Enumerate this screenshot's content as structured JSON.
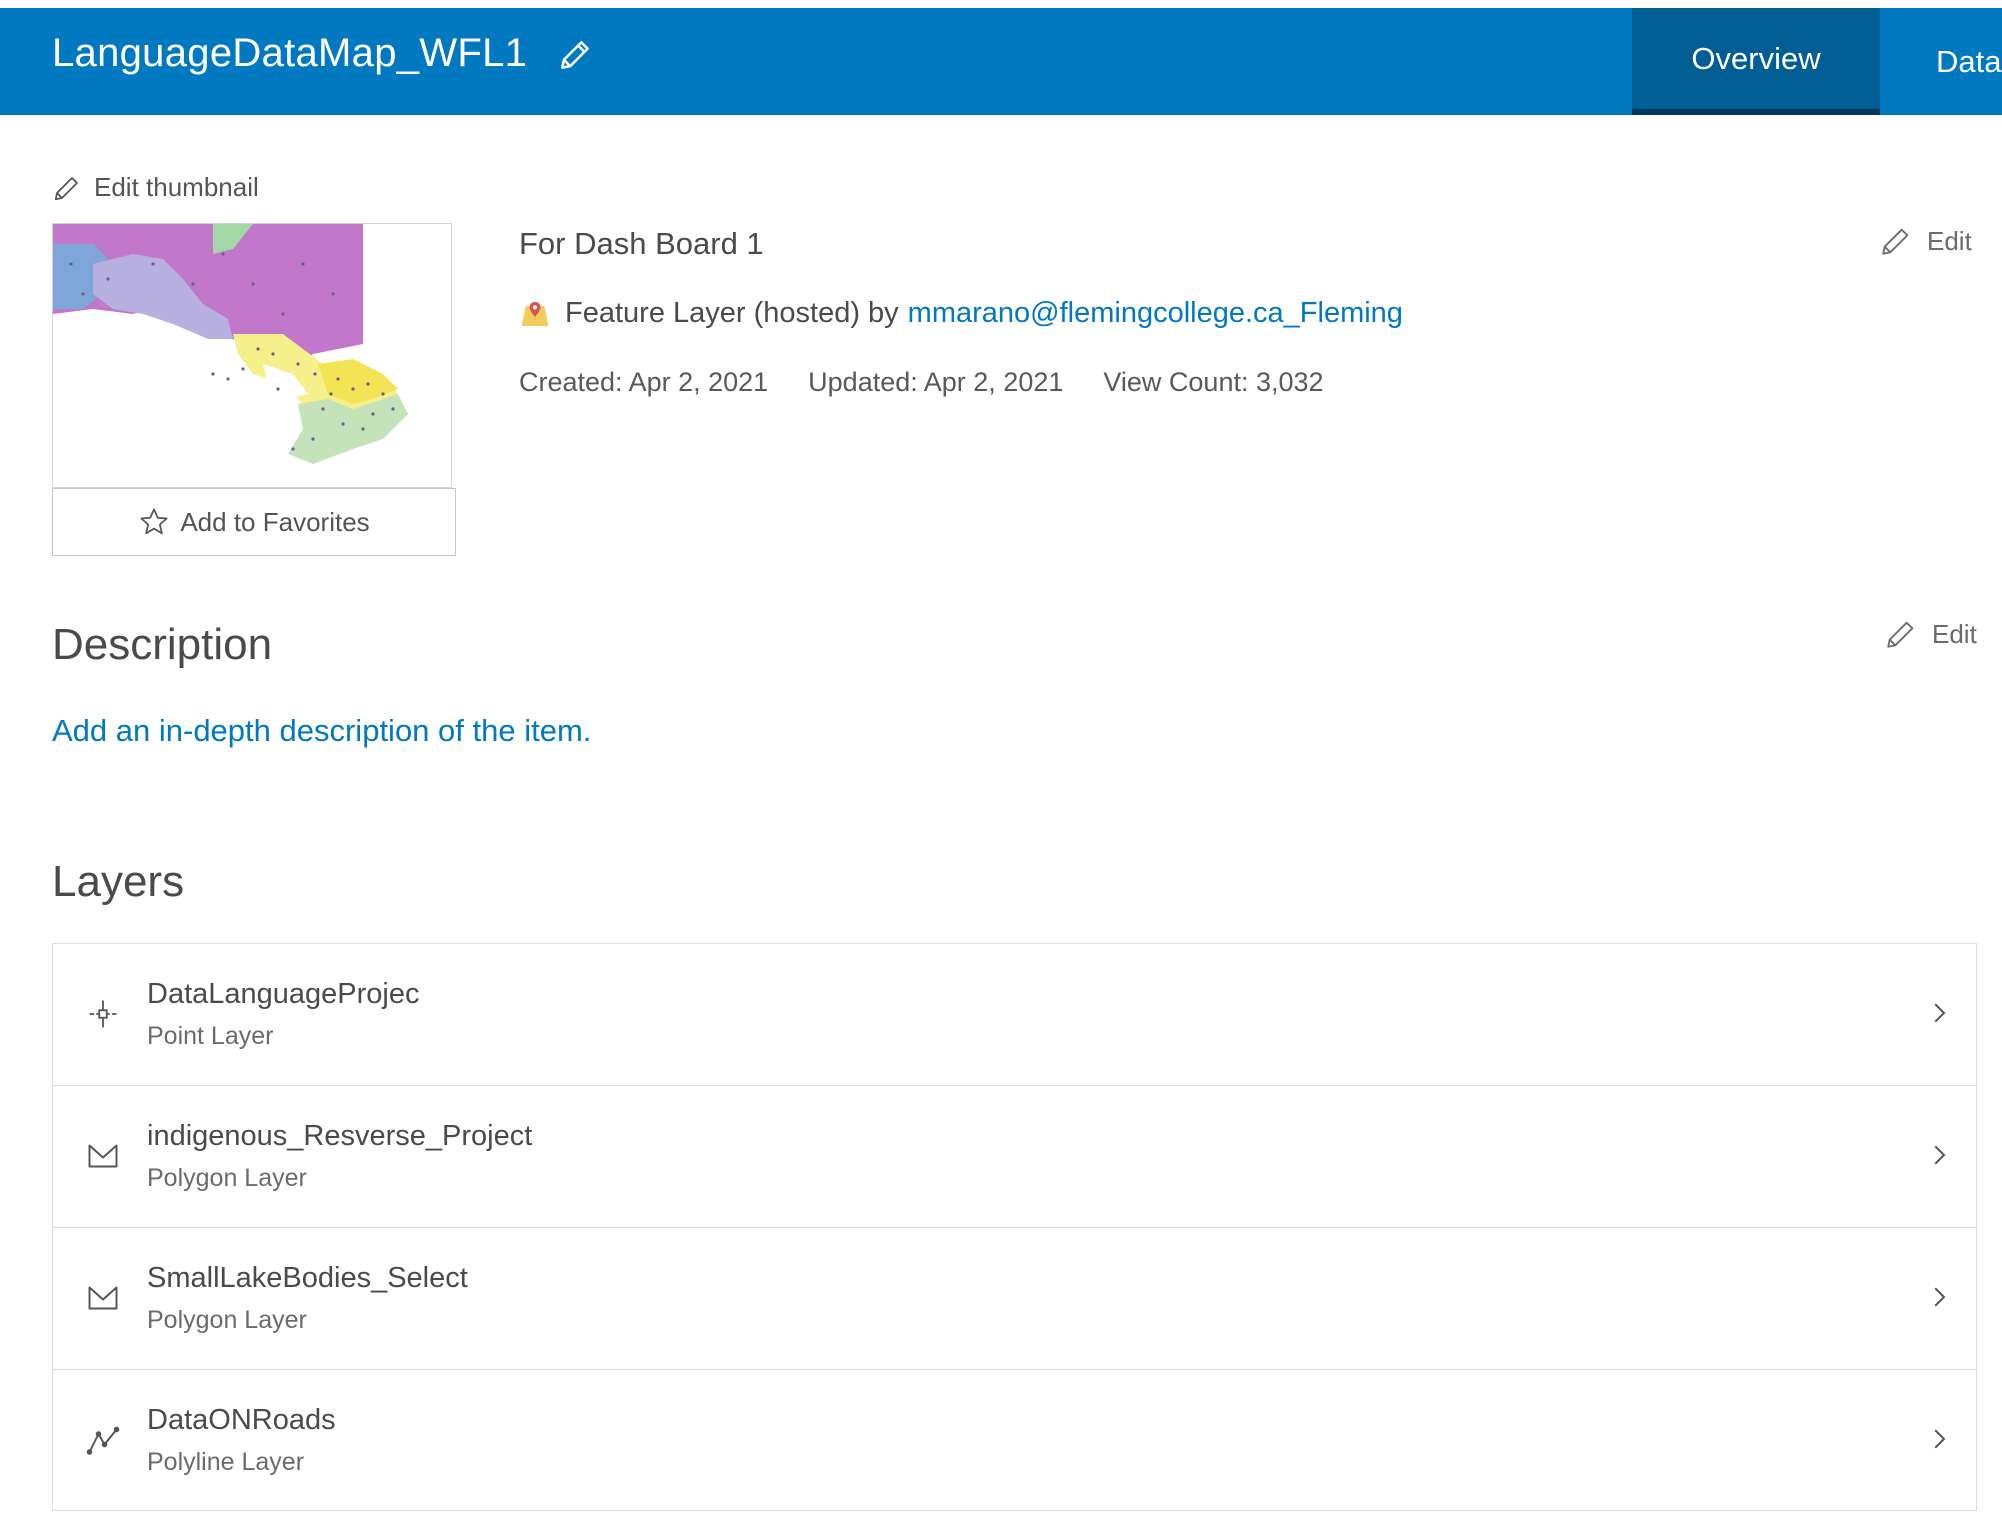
{
  "header": {
    "title": "LanguageDataMap_WFL1",
    "tabs": [
      {
        "label": "Overview",
        "active": true
      },
      {
        "label": "Data",
        "active": false
      }
    ],
    "background_color": "#0079c1",
    "active_tab_color": "#005e95"
  },
  "thumbnail": {
    "edit_label": "Edit thumbnail",
    "favorites_label": "Add to Favorites"
  },
  "item": {
    "summary": "For Dash Board 1",
    "type_text": "Feature Layer (hosted) by",
    "owner": "mmarano@flemingcollege.ca_Fleming",
    "created": "Created: Apr 2, 2021",
    "updated": "Updated: Apr 2, 2021",
    "view_count": "View Count: 3,032",
    "edit_label": "Edit"
  },
  "description": {
    "heading": "Description",
    "placeholder_link": "Add an in-depth description of the item.",
    "edit_label": "Edit"
  },
  "layers": {
    "heading": "Layers",
    "items": [
      {
        "name": "DataLanguageProjec",
        "type": "Point Layer",
        "icon": "point-layer-icon"
      },
      {
        "name": "indigenous_Resverse_Project",
        "type": "Polygon Layer",
        "icon": "polygon-layer-icon"
      },
      {
        "name": "SmallLakeBodies_Select",
        "type": "Polygon Layer",
        "icon": "polygon-layer-icon"
      },
      {
        "name": "DataONRoads",
        "type": "Polyline Layer",
        "icon": "polyline-layer-icon"
      }
    ]
  },
  "colors": {
    "link": "#0079c1",
    "text": "#4a4a4a"
  }
}
